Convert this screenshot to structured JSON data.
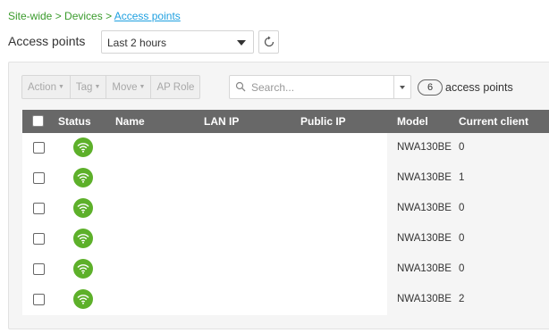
{
  "breadcrumb": {
    "site": "Site-wide",
    "sep1": " > ",
    "devices": "Devices",
    "sep2": " > ",
    "current": "Access points"
  },
  "header": {
    "title": "Access points",
    "time_range": "Last 2 hours"
  },
  "toolbar": {
    "action": "Action",
    "tag": "Tag",
    "move": "Move",
    "ap_role": "AP Role",
    "search_placeholder": "Search...",
    "count": "6",
    "count_label": "access points"
  },
  "table": {
    "columns": [
      "Status",
      "Name",
      "LAN IP",
      "Public IP",
      "Model",
      "Current client"
    ],
    "rows": [
      {
        "status": "online",
        "name": "",
        "lan_ip": "",
        "public_ip": "",
        "model": "NWA130BE",
        "clients": "0"
      },
      {
        "status": "online",
        "name": "",
        "lan_ip": "",
        "public_ip": "",
        "model": "NWA130BE",
        "clients": "1"
      },
      {
        "status": "online",
        "name": "",
        "lan_ip": "",
        "public_ip": "",
        "model": "NWA130BE",
        "clients": "0"
      },
      {
        "status": "online",
        "name": "",
        "lan_ip": "",
        "public_ip": "",
        "model": "NWA130BE",
        "clients": "0"
      },
      {
        "status": "online",
        "name": "",
        "lan_ip": "",
        "public_ip": "",
        "model": "NWA130BE",
        "clients": "0"
      },
      {
        "status": "online",
        "name": "",
        "lan_ip": "",
        "public_ip": "",
        "model": "NWA130BE",
        "clients": "2"
      }
    ]
  },
  "colors": {
    "breadcrumb": "#3a9b2c",
    "link": "#1fa0e0",
    "status_online": "#5db02a",
    "table_header": "#686868"
  },
  "icons": {
    "status": "wifi-icon",
    "refresh": "refresh-icon",
    "search": "search-icon"
  }
}
